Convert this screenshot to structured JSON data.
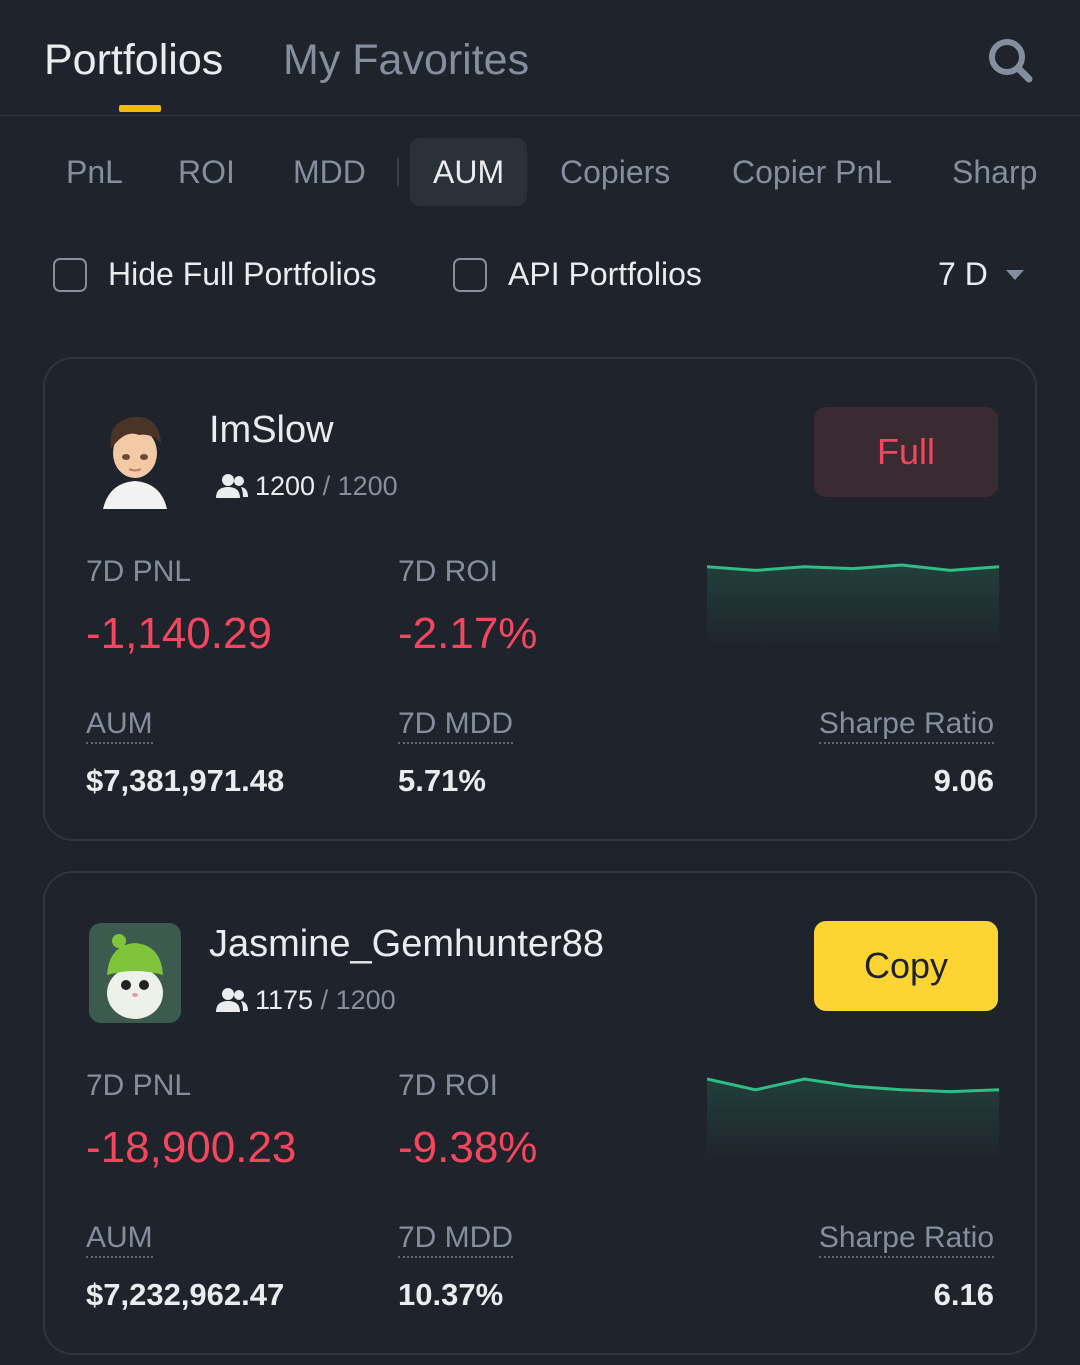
{
  "top_tabs": {
    "portfolios": "Portfolios",
    "favorites": "My Favorites"
  },
  "sort_tabs": [
    "PnL",
    "ROI",
    "MDD",
    "AUM",
    "Copiers",
    "Copier PnL",
    "Sharp"
  ],
  "sort_active": "AUM",
  "filters": {
    "hide_full": "Hide Full Portfolios",
    "api": "API Portfolios",
    "period": "7 D"
  },
  "colors": {
    "accent": "#f0b90b",
    "negative": "#f6465d",
    "positive": "#2ebd85",
    "copy_button": "#fcd535"
  },
  "cards": [
    {
      "name": "ImSlow",
      "copiers_current": "1200",
      "copiers_max": "/ 1200",
      "button": "Full",
      "pnl_label": "7D PNL",
      "pnl": "-1,140.29",
      "roi_label": "7D ROI",
      "roi": "-2.17%",
      "aum_label": "AUM",
      "aum": "$7,381,971.48",
      "mdd_label": "7D MDD",
      "mdd": "5.71%",
      "sharpe_label": "Sharpe Ratio",
      "sharpe": "9.06",
      "spark": [
        2,
        0,
        2,
        1,
        3,
        0,
        2
      ]
    },
    {
      "name": "Jasmine_Gemhunter88",
      "copiers_current": "1175",
      "copiers_max": "/ 1200",
      "button": "Copy",
      "pnl_label": "7D PNL",
      "pnl": "-18,900.23",
      "roi_label": "7D ROI",
      "roi": "-9.38%",
      "aum_label": "AUM",
      "aum": "$7,232,962.47",
      "mdd_label": "7D MDD",
      "mdd": "10.37%",
      "sharpe_label": "Sharpe Ratio",
      "sharpe": "6.16",
      "spark": [
        7,
        1,
        7,
        3,
        1,
        0,
        1
      ]
    }
  ]
}
